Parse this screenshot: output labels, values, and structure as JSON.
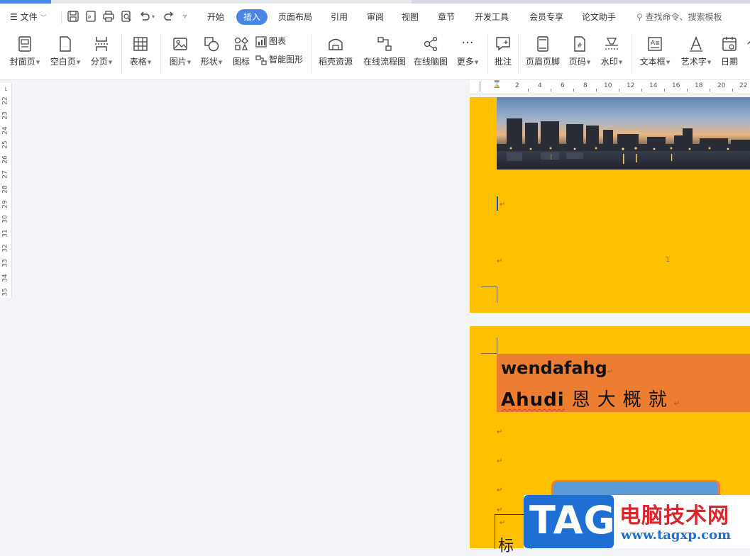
{
  "menubar": {
    "file": "文件",
    "tabs": [
      {
        "label": "开始"
      },
      {
        "label": "插入"
      },
      {
        "label": "页面布局"
      },
      {
        "label": "引用"
      },
      {
        "label": "审阅"
      },
      {
        "label": "视图"
      },
      {
        "label": "章节"
      },
      {
        "label": "开发工具"
      },
      {
        "label": "会员专享"
      },
      {
        "label": "论文助手"
      }
    ],
    "active_tab": "插入",
    "search_placeholder": "查找命令、搜索模板"
  },
  "ribbon": {
    "cover_page": "封面页",
    "blank_page": "空白页",
    "page_break": "分页",
    "table": "表格",
    "picture": "图片",
    "shape": "形状",
    "icon": "图标",
    "chart": "图表",
    "smart_art": "智能图形",
    "docer_resources": "稻壳资源",
    "online_flowchart": "在线流程图",
    "online_mindmap": "在线脑图",
    "more": "更多",
    "comment": "批注",
    "header_footer": "页眉页脚",
    "page_number": "页码",
    "watermark": "水印",
    "text_box": "文本框",
    "word_art": "艺术字",
    "date": "日期"
  },
  "vruler": [
    "22",
    "23",
    "24",
    "25",
    "26",
    "27",
    "28",
    "29",
    "30",
    "31",
    "32",
    "33",
    "34",
    "35"
  ],
  "hruler": [
    "2",
    "4",
    "6",
    "8",
    "10",
    "12",
    "14",
    "16",
    "18",
    "20",
    "22"
  ],
  "page1": {
    "paragraph_mark": "↵",
    "page_number": "1"
  },
  "page2": {
    "heading1": "wendafahg",
    "heading2_latin": "Ahudi",
    "heading2_cjk": "恩大概就",
    "paragraph_mark": "↵",
    "textbox_char": "标"
  },
  "watermark": {
    "tag": "TAG",
    "site_name": "电脑技术网",
    "url": "www.tagxp.com"
  },
  "colors": {
    "accent": "#4a86e8",
    "page_bg": "#ffc000",
    "heading_bg": "#ed7d31",
    "shape_fill": "#5b9bd5"
  }
}
